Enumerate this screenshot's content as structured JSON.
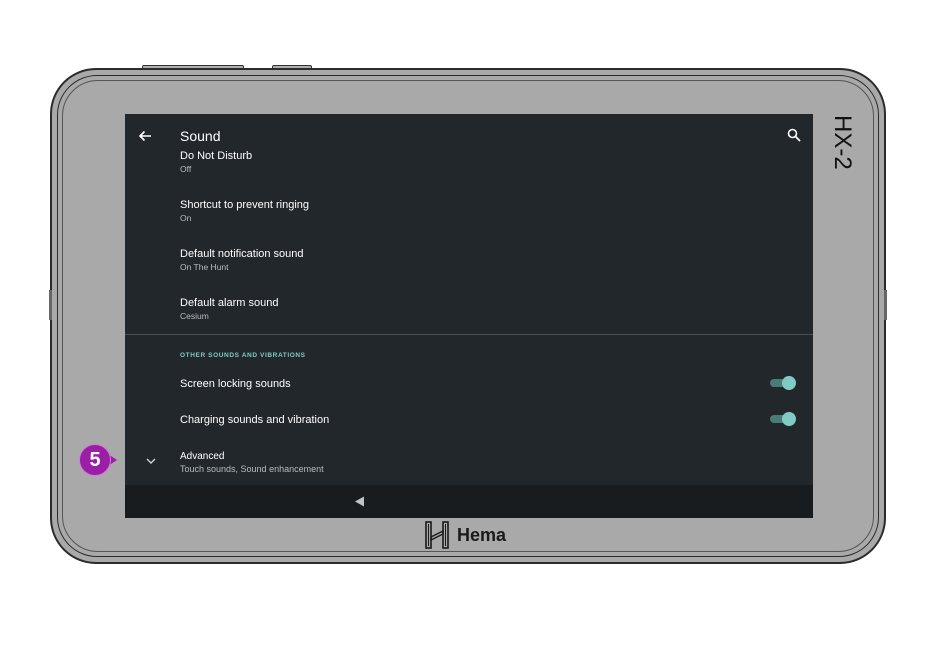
{
  "device": {
    "model": "HX-2",
    "brand": "Hema"
  },
  "toolbar": {
    "title": "Sound",
    "back_icon": "arrow-back-icon",
    "search_icon": "search-icon"
  },
  "settings": {
    "items": [
      {
        "title": "Do Not Disturb",
        "subtitle": "Off"
      },
      {
        "title": "Shortcut to prevent ringing",
        "subtitle": "On"
      },
      {
        "title": "Default notification sound",
        "subtitle": "On The Hunt"
      },
      {
        "title": "Default alarm sound",
        "subtitle": "Cesium"
      }
    ],
    "section_header": "OTHER SOUNDS AND VIBRATIONS",
    "toggles": [
      {
        "title": "Screen locking sounds",
        "checked": true
      },
      {
        "title": "Charging sounds and vibration",
        "checked": true
      }
    ],
    "advanced": {
      "title": "Advanced",
      "subtitle": "Touch sounds, Sound enhancement"
    }
  },
  "navbar": {
    "back_icon": "nav-back-icon"
  },
  "callout": {
    "number": "5"
  },
  "colors": {
    "screen_bg": "#22272c",
    "accent": "#80cbc4",
    "callout": "#9b1fa6",
    "device_frame": "#a9a9a9"
  }
}
